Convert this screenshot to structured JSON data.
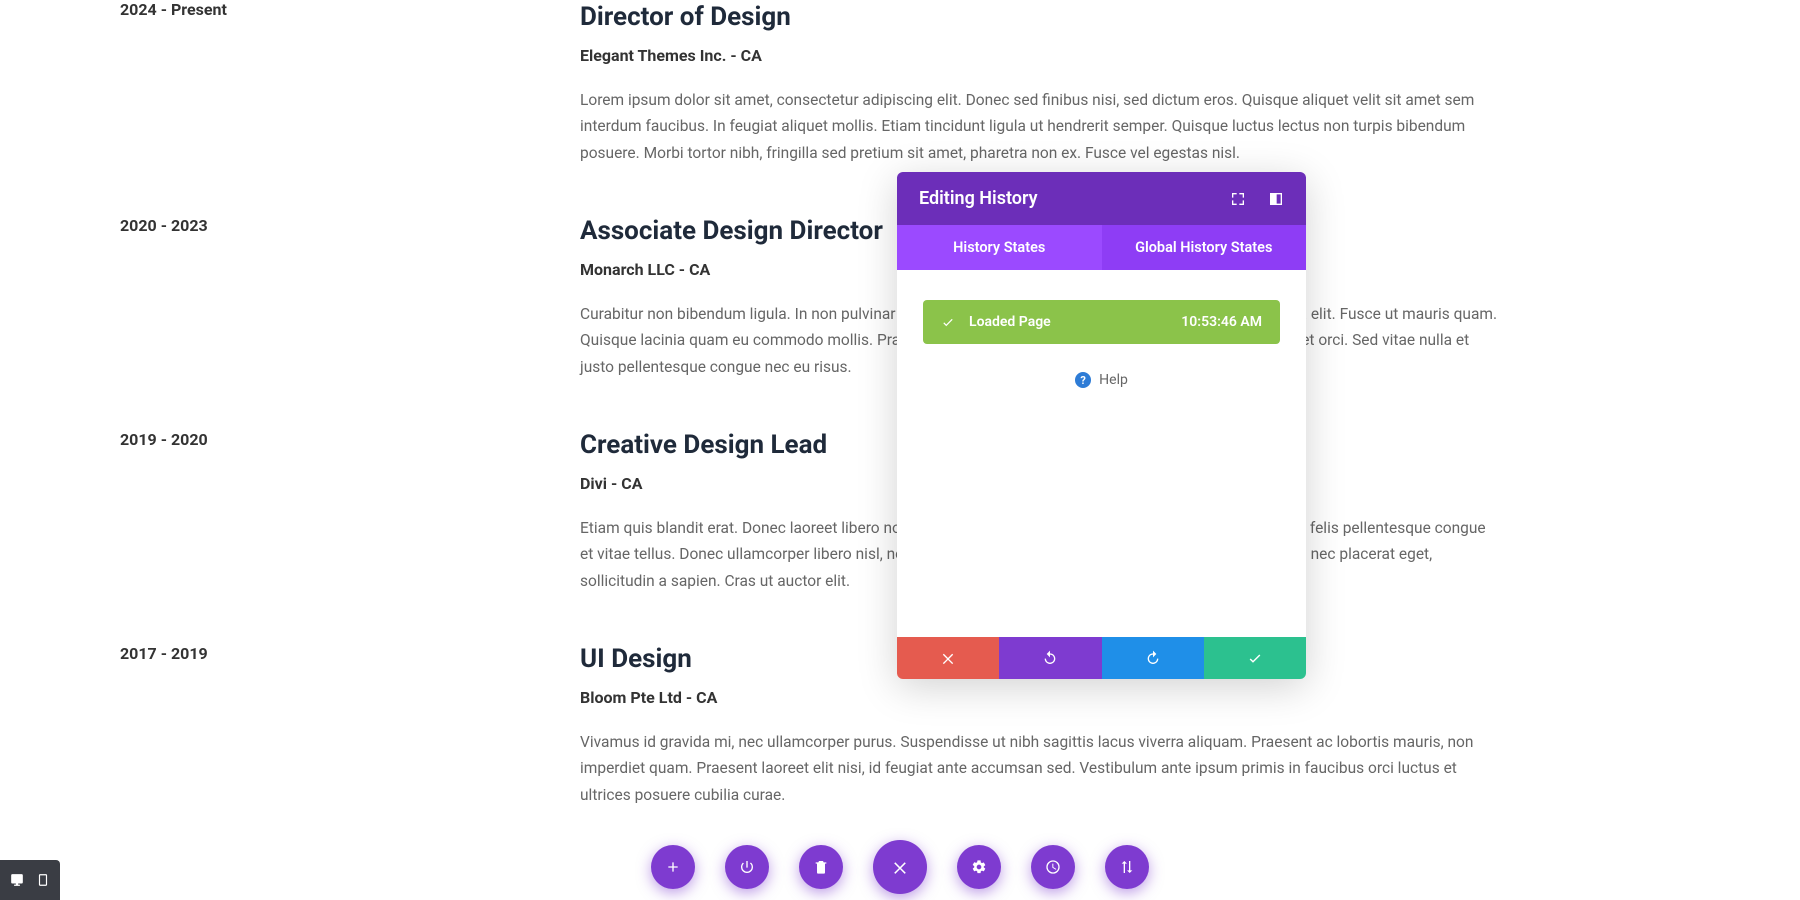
{
  "resume": {
    "entries": [
      {
        "dates": "2024 - Present",
        "title": "Director of Design",
        "company": "Elegant Themes Inc. - CA",
        "desc": "Lorem ipsum dolor sit amet, consectetur adipiscing elit. Donec sed finibus nisi, sed dictum eros. Quisque aliquet velit sit amet sem interdum faucibus. In feugiat aliquet mollis. Etiam tincidunt ligula ut hendrerit semper. Quisque luctus lectus non turpis bibendum posuere. Morbi tortor nibh, fringilla sed pretium sit amet, pharetra non ex. Fusce vel egestas nisl."
      },
      {
        "dates": "2020 - 2023",
        "title": "Associate Design Director",
        "company": "Monarch LLC - CA",
        "desc": "Curabitur non bibendum ligula. In non pulvinar purus. Curabitur nisi odio, blandit et elit at, suscipit pharetra elit. Fusce ut mauris quam. Quisque lacinia quam eu commodo mollis. Praesent nisl massa, ultrices vitae ornare sit amet, ultricies eget orci. Sed vitae nulla et justo pellentesque congue nec eu risus."
      },
      {
        "dates": "2019 - 2020",
        "title": "Creative Design Lead",
        "company": "Divi - CA",
        "desc": "Etiam quis blandit erat. Donec laoreet libero non metus volutpat consequat in vel metus. Sed non augue id felis pellentesque congue et vitae tellus. Donec ullamcorper libero nisl, nec blandit dolor tempus feugiat. Aenean neque felis, fringilla nec placerat eget, sollicitudin a sapien. Cras ut auctor elit."
      },
      {
        "dates": "2017 - 2019",
        "title": "UI Design",
        "company": "Bloom Pte Ltd - CA",
        "desc": "Vivamus id gravida mi, nec ullamcorper purus. Suspendisse ut nibh sagittis lacus viverra aliquam. Praesent ac lobortis mauris, non imperdiet quam. Praesent laoreet elit nisi, id feugiat ante accumsan sed. Vestibulum ante ipsum primis in faucibus orci luctus et ultrices posuere cubilia curae."
      }
    ]
  },
  "panel": {
    "title": "Editing History",
    "tabs": {
      "history": "History States",
      "global": "Global History States"
    },
    "entry": {
      "label": "Loaded Page",
      "time": "10:53:46 AM"
    },
    "help_label": "Help"
  }
}
